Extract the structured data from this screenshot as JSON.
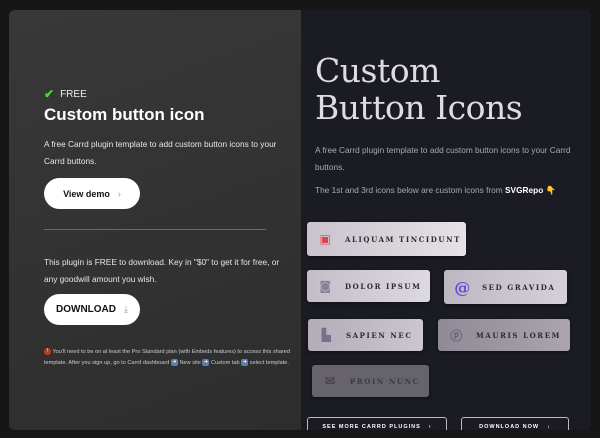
{
  "left": {
    "badge": "FREE",
    "title": "Custom button icon",
    "description": "A free Carrd plugin template to add custom button icons to your Carrd buttons.",
    "view_demo": "View demo",
    "view_demo_icon": "›",
    "pricing": "This plugin is FREE to download. Key in \"$0\" to get it for free, or any goodwill amount you wish.",
    "download": "DOWNLOAD",
    "download_icon": "⤓",
    "note_1": "You'll need to be on at least the Pro Standard plan (with Embeds features) to access this shared template. After you sign up, go to Carrd dashboard",
    "note_2": "New site",
    "note_3": "Custom tab",
    "note_4": "select template."
  },
  "right": {
    "title": "Custom Button Icons",
    "description": "A free Carrd plugin template to add custom button icons to your Carrd buttons.",
    "credit_prefix": "The 1st and 3rd icons below are custom icons from",
    "credit_link": "SVGRepo",
    "buttons": [
      {
        "label": "ALIQUAM TINCIDUNT",
        "icon": "robot-icon"
      },
      {
        "label": "DOLOR IPSUM",
        "icon": "instagram-icon"
      },
      {
        "label": "SED GRAVIDA",
        "icon": "spiral-icon"
      },
      {
        "label": "SAPIEN NEC",
        "icon": "inbox-icon"
      },
      {
        "label": "MAURIS LOREM",
        "icon": "pinterest-icon"
      },
      {
        "label": "PROIN NUNC",
        "icon": "envelope-icon"
      }
    ],
    "see_more": "SEE MORE CARRD PLUGINS",
    "see_more_icon": "›",
    "download_now": "DOWNLOAD NOW",
    "download_now_icon": "↓"
  },
  "colors": {
    "check": "#4cd63a",
    "robot": "#e04050",
    "spiral": "#5a4fd8"
  }
}
